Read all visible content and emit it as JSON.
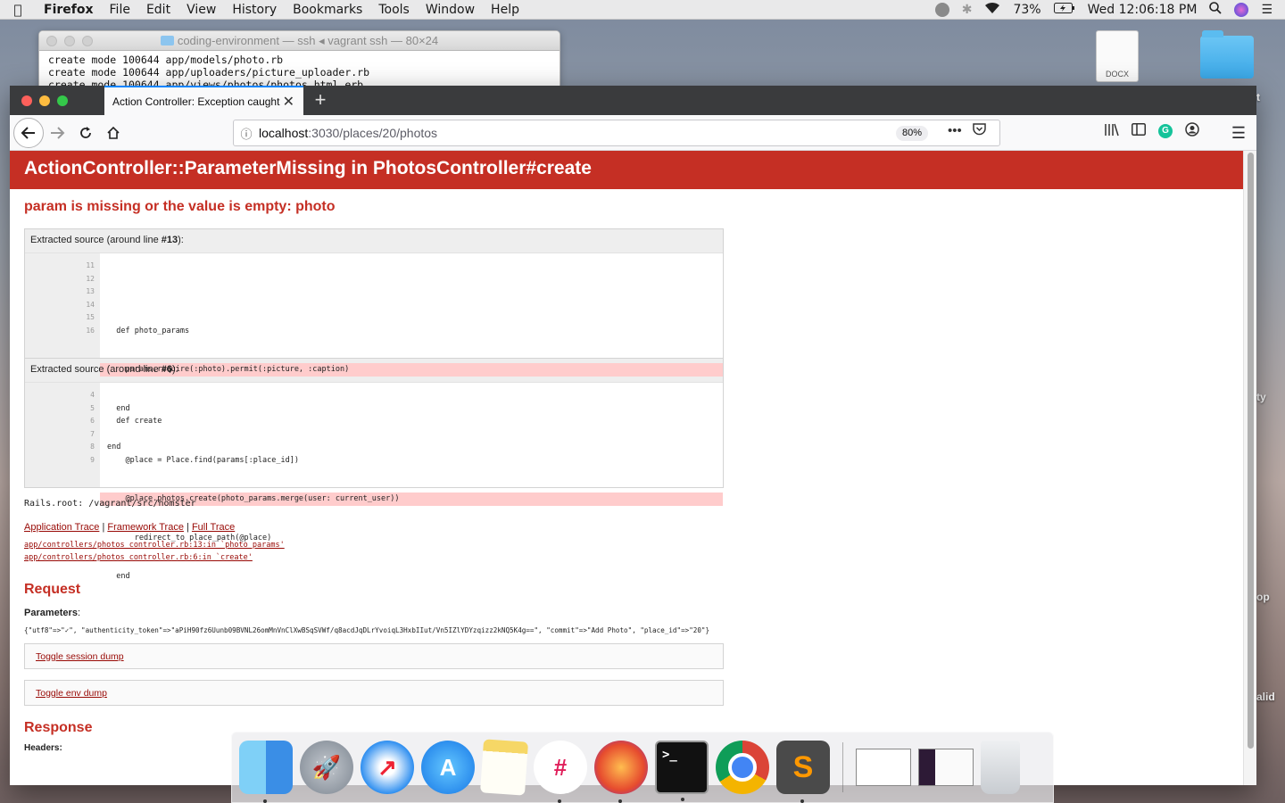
{
  "menubar": {
    "app": "Firefox",
    "items": [
      "File",
      "Edit",
      "View",
      "History",
      "Bookmarks",
      "Tools",
      "Window",
      "Help"
    ],
    "battery": "73%",
    "clock": "Wed 12:06:18 PM"
  },
  "terminal": {
    "title": "coding-environment — ssh ◂ vagrant ssh — 80×24",
    "lines": [
      "create mode 100644 app/models/photo.rb",
      "create mode 100644 app/uploaders/picture_uploader.rb",
      "create mode 100644 app/views/photos/photos_html.erb"
    ]
  },
  "desktop": {
    "docx_label": "DOCX",
    "side_labels": [
      "ty",
      "op",
      "alid",
      "t"
    ]
  },
  "browser": {
    "tab_title": "Action Controller: Exception caught",
    "url_host": "localhost",
    "url_path": ":3030/places/20/photos",
    "zoom": "80%"
  },
  "page": {
    "header": "ActionController::ParameterMissing in PhotosController#create",
    "message": "param is missing or the value is empty: photo",
    "sources": [
      {
        "head_prefix": "Extracted source (around line ",
        "head_line": "#13",
        "head_suffix": "):",
        "line_numbers": [
          "11",
          "12",
          "13",
          "14",
          "15",
          "16"
        ],
        "code": [
          "",
          "  def photo_params",
          "    params.require(:photo).permit(:picture, :caption)",
          "  end",
          "end",
          ""
        ],
        "highlight_index": 2
      },
      {
        "head_prefix": "Extracted source (around line ",
        "head_line": "#6",
        "head_suffix": "):",
        "line_numbers": [
          "4",
          "5",
          "6",
          "7",
          "8",
          "9"
        ],
        "code": [
          "  def create",
          "    @place = Place.find(params[:place_id])",
          "    @place.photos.create(photo_params.merge(user: current_user))",
          "      redirect_to place_path(@place)",
          "  end",
          ""
        ],
        "highlight_index": 2
      }
    ],
    "rails_root": "Rails.root: /vagrant/src/nomster",
    "trace_links": [
      "Application Trace",
      "Framework Trace",
      "Full Trace"
    ],
    "trace_sep": " | ",
    "trace_items": [
      "app/controllers/photos_controller.rb:13:in `photo_params'",
      "app/controllers/photos_controller.rb:6:in `create'"
    ],
    "request_title": "Request",
    "parameters_label": "Parameters",
    "parameters_colon": ":",
    "parameters_value": "{\"utf8\"=>\"✓\", \"authenticity_token\"=>\"aPiH90fz6Uunb09BVNL26omMnVnClXwBSqSVWf/q8acdJqDLrYvoiqL3HxbIIut/Vn5IZlYDYzqizz2kNQ5K4g==\", \"commit\"=>\"Add Photo\", \"place_id\"=>\"20\"}",
    "toggle_session": "Toggle session dump",
    "toggle_env": "Toggle env dump",
    "response_title": "Response",
    "headers_label": "Headers:"
  },
  "dock": {
    "apps": [
      "Finder",
      "Launchpad",
      "Safari",
      "App Store",
      "Notes",
      "Slack",
      "Firefox",
      "Terminal",
      "Chrome",
      "Sublime Text"
    ]
  }
}
